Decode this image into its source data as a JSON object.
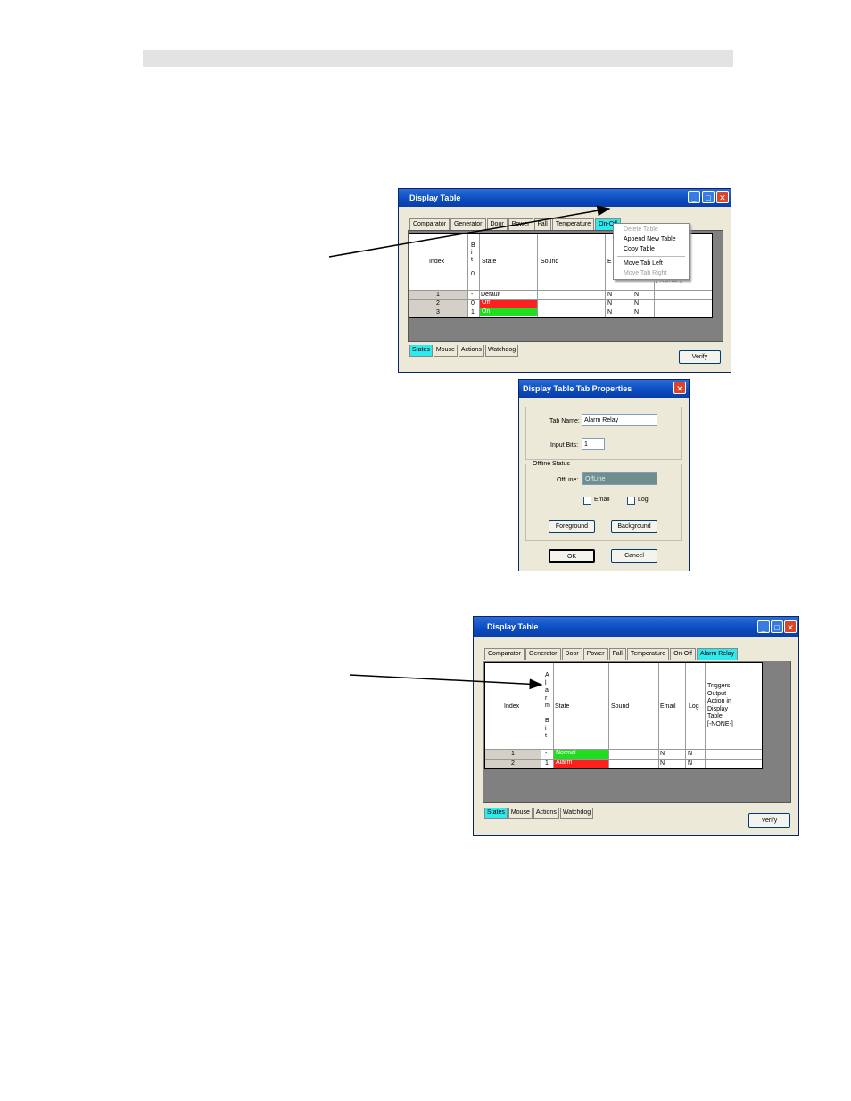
{
  "win1": {
    "title": "Display Table",
    "top_tabs": [
      "Comparator",
      "Generator",
      "Door",
      "Power",
      "Fall",
      "Temperature",
      "On-Off"
    ],
    "headers": {
      "index": "Index",
      "bit": "B\ni\nt\n\n0",
      "state": "State",
      "sound": "Sound",
      "email": "E",
      "log": "",
      "triggers": "[-NONE-]"
    },
    "rows": [
      {
        "index": "1",
        "bit": "-",
        "state": "Default",
        "email": "N",
        "log": "N",
        "color": ""
      },
      {
        "index": "2",
        "bit": "0",
        "state": "Off",
        "email": "N",
        "log": "N",
        "color": "#ff2020"
      },
      {
        "index": "3",
        "bit": "1",
        "state": "On",
        "email": "N",
        "log": "N",
        "color": "#20dd20"
      }
    ],
    "bottom_tabs": [
      "States",
      "Mouse",
      "Actions",
      "Watchdog"
    ],
    "verify": "Verify",
    "menu": [
      "Delete Table",
      "Append New Table",
      "Copy Table",
      "Move Tab Left",
      "Move Tab Right"
    ],
    "menu_disabled": [
      true,
      false,
      false,
      false,
      true
    ]
  },
  "dialog": {
    "title": "Display Table Tab Properties",
    "tab_name_label": "Tab Name:",
    "tab_name_value": "Alarm Relay",
    "input_bits_label": "Input Bits:",
    "input_bits_value": "1",
    "offline_group": "Offline Status",
    "offline_label": "OffLine:",
    "offline_value": "OffLine",
    "email_label": "Email",
    "log_label": "Log",
    "foreground": "Foreground",
    "background": "Background",
    "ok": "OK",
    "cancel": "Cancel"
  },
  "win2": {
    "title": "Display Table",
    "top_tabs": [
      "Comparator",
      "Generator",
      "Door",
      "Power",
      "Fall",
      "Temperature",
      "On-Off",
      "Alarm Relay"
    ],
    "headers": {
      "index": "Index",
      "bit": "A\nl\na\nr\nm\n\nB\ni\nt",
      "state": "State",
      "sound": "Sound",
      "email": "Email",
      "log": "Log",
      "triggers": "Triggers\nOutput\nAction in\nDisplay\nTable:\n[-NONE-]"
    },
    "rows": [
      {
        "index": "1",
        "bit": "-",
        "state": "Normal",
        "email": "N",
        "log": "N",
        "color": "#20dd20"
      },
      {
        "index": "2",
        "bit": "1",
        "state": "Alarm",
        "email": "N",
        "log": "N",
        "color": "#ff2020"
      }
    ],
    "bottom_tabs": [
      "States",
      "Mouse",
      "Actions",
      "Watchdog"
    ],
    "verify": "Verify"
  },
  "colors": {
    "selected_tab": "#2ee9ee",
    "title_bar": "#0a4bbf",
    "grid_background": "#808080"
  }
}
